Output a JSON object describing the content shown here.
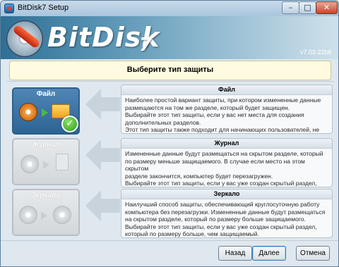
{
  "window": {
    "title": "BitDisk7 Setup"
  },
  "titlebar": {
    "min": "–",
    "max": "□",
    "close": "✕"
  },
  "banner": {
    "logo_text": "BitDisk",
    "logo_digit": "7",
    "version": "v7.03.22bit"
  },
  "header": {
    "title": "Выберите тип защиты"
  },
  "options": [
    {
      "label": "Файл",
      "selected": true,
      "panel_title": "Файл",
      "description": "Наиболее простой вариант защиты, при котором измененные данные\nразмещаются на том же разделе, который будет защищен.\nВыбирайте этот тип защиты, если у вас нет места для создания\nдополнительных разделов.\nЭтот тип защиты также подходит для начинающих пользователей, не\nимеющих опыта в создании разделов на жестком диске."
    },
    {
      "label": "Журнал",
      "selected": false,
      "panel_title": "Журнал",
      "description": "Измененные данные будут размещаться на скрытом разделе, который\nпо размеру меньше защищаемого. В случае если место на этом скрытом\nразделе закончится, компьютер будет перезагружен.\nВыбирайте этот тип защиты, если у вас уже создан скрытый раздел,\nкоторый по размеру меньше, чем защищаемый."
    },
    {
      "label": "Зеркало",
      "selected": false,
      "panel_title": "Зеркало",
      "description": "Наилучший способ защиты, обеспечивающий круглосуточную работу\nкомпьютера без перезагрузки. Измененные данные будут размещаться\nна скрытом разделе, который по размеру больше защищаемого.\nВыбирайте этот тип защиты, если у вас уже создан скрытый раздел,\nкоторый по размеру больше, чем защищаемый."
    }
  ],
  "footer": {
    "back": "Назад",
    "next": "Далее",
    "cancel": "Отмена"
  },
  "colors": {
    "selected_option": "#2d6494",
    "header_bg": "#fffbe1",
    "banner": "#2e6f95"
  }
}
